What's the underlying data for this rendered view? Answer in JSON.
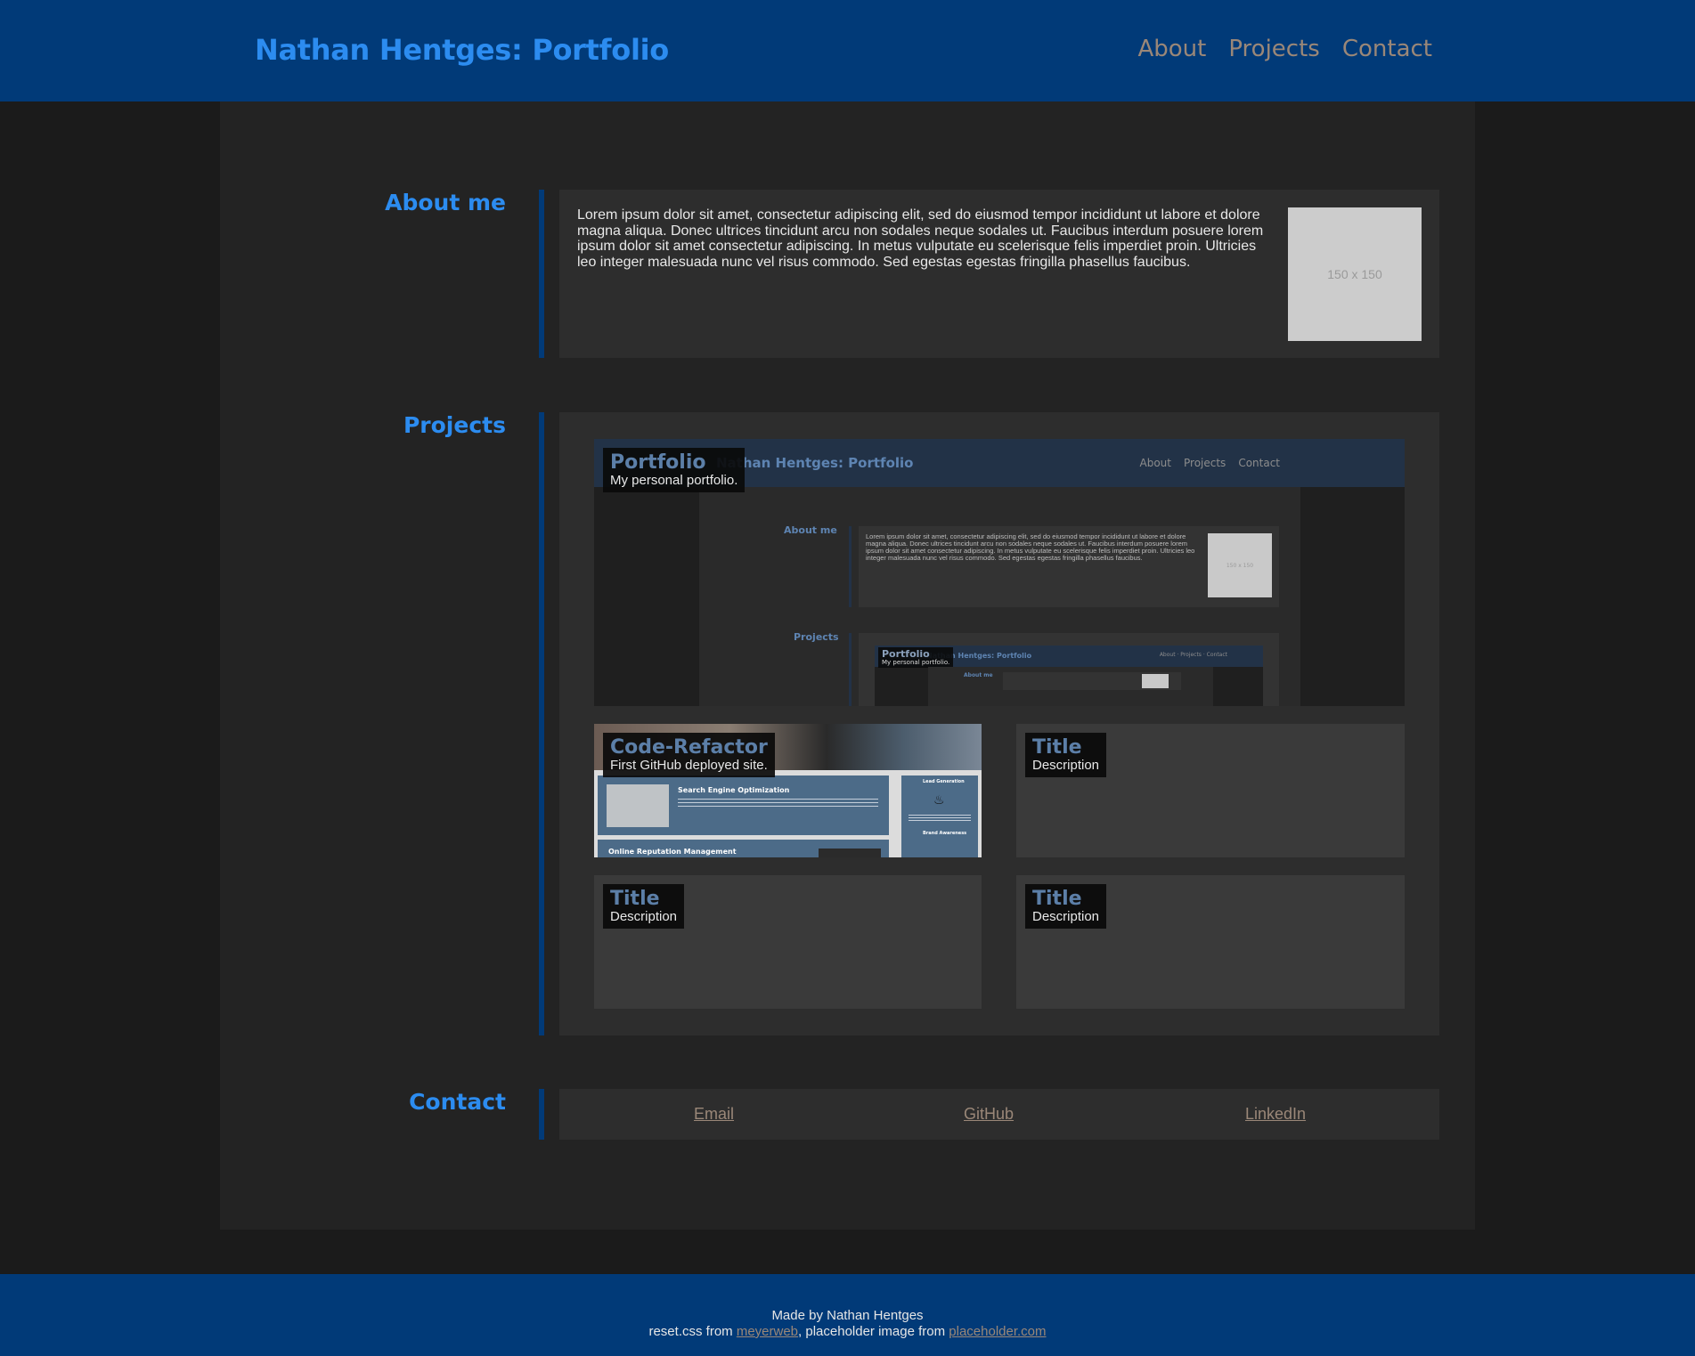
{
  "header": {
    "title": "Nathan Hentges: Portfolio",
    "nav": [
      "About",
      "Projects",
      "Contact"
    ]
  },
  "about": {
    "label": "About me",
    "text": "Lorem ipsum dolor sit amet, consectetur adipiscing elit, sed do eiusmod tempor incididunt ut labore et dolore magna aliqua. Donec ultrices tincidunt arcu non sodales neque sodales ut. Faucibus interdum posuere lorem ipsum dolor sit amet consectetur adipiscing. In metus vulputate eu scelerisque felis imperdiet proin. Ultricies leo integer malesuada nunc vel risus commodo. Sed egestas egestas fringilla phasellus faucibus.",
    "image_label": "150 x 150"
  },
  "projects": {
    "label": "Projects",
    "items": [
      {
        "title": "Portfolio",
        "description": "My personal portfolio."
      },
      {
        "title": "Code-Refactor",
        "description": "First GitHub deployed site."
      },
      {
        "title": "Title",
        "description": "Description"
      },
      {
        "title": "Title",
        "description": "Description"
      },
      {
        "title": "Title",
        "description": "Description"
      }
    ],
    "preview": {
      "title": "Nathan Hentges: Portfolio",
      "nav": [
        "About",
        "Projects",
        "Contact"
      ],
      "about_label": "About me",
      "projects_label": "Projects",
      "about_text": "Lorem ipsum dolor sit amet, consectetur adipiscing elit, sed do eiusmod tempor incididunt ut labore et dolore magna aliqua. Donec ultrices tincidunt arcu non sodales neque sodales ut. Faucibus interdum posuere lorem ipsum dolor sit amet consectetur adipiscing. In metus vulputate eu scelerisque felis imperdiet proin. Ultricies leo integer malesuada nunc vel risus commodo. Sed egestas egestas fringilla phasellus faucibus.",
      "image_label": "150 x 150",
      "nested_title": "Portfolio",
      "nested_desc": "My personal portfolio.",
      "nested_header": "Nathan Hentges: Portfolio",
      "nested_about": "About me"
    },
    "code_refactor_preview": {
      "seo": "Search Engine Optimization",
      "orm": "Online Reputation Management",
      "lead": "Lead Generation",
      "brand": "Brand Awareness"
    }
  },
  "contact": {
    "label": "Contact",
    "links": [
      "Email",
      "GitHub",
      "LinkedIn"
    ]
  },
  "footer": {
    "made_by": "Made by Nathan Hentges",
    "reset_prefix": "reset.css from ",
    "reset_link": "meyerweb",
    "image_prefix": ", placeholder image from ",
    "image_link": "placeholder.com"
  }
}
